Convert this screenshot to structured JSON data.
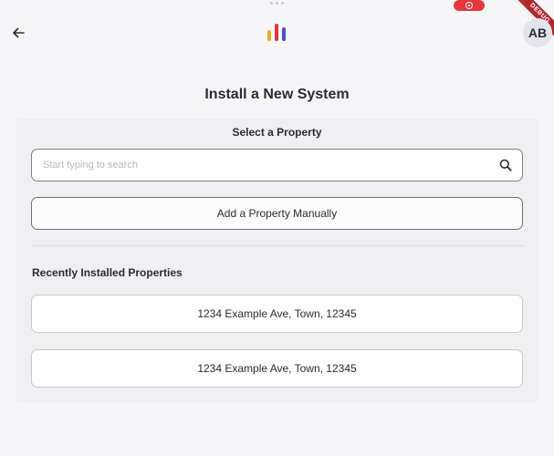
{
  "app_bar": {
    "back_icon": "arrow-left-icon",
    "logo_icon": "bar-chart-logo-icon",
    "logo_colors": [
      "#f5a623",
      "#e0364b",
      "#4a4fd6"
    ],
    "avatar_initials": "AB"
  },
  "system_overlays": {
    "record_icon": "screen-record-icon",
    "record_color": "#e5363e",
    "debug_banner": "DEBUG"
  },
  "page": {
    "title": "Install a New System",
    "select_property_label": "Select a Property",
    "search": {
      "placeholder": "Start typing to search",
      "value": "",
      "icon": "search-icon"
    },
    "add_manually_label": "Add a Property Manually",
    "recent_label": "Recently Installed Properties",
    "recent_properties": [
      {
        "address": "1234 Example Ave, Town, 12345"
      },
      {
        "address": "1234 Example Ave, Town, 12345"
      }
    ]
  }
}
